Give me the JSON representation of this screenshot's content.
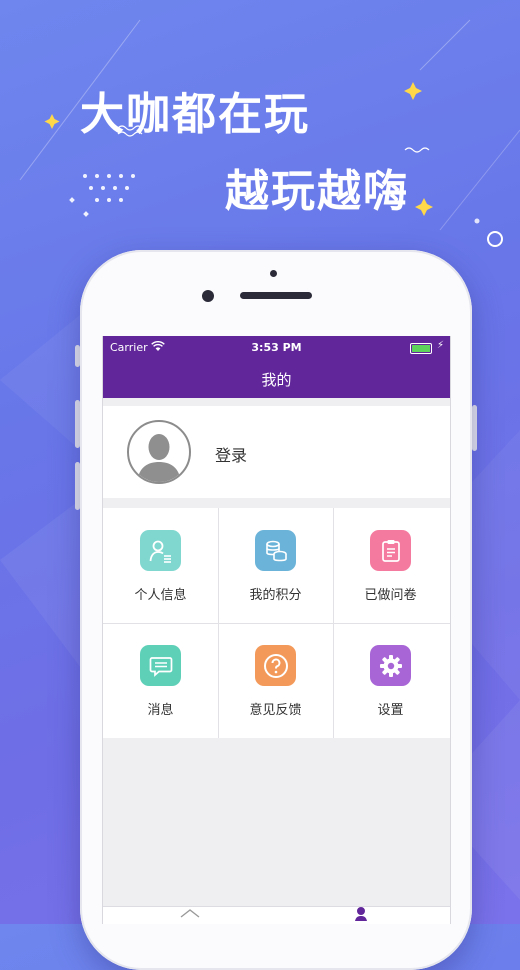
{
  "promo": {
    "headline1": "大咖都在玩",
    "headline2": "越玩越嗨"
  },
  "status_bar": {
    "carrier": "Carrier",
    "time": "3:53 PM"
  },
  "nav": {
    "title": "我的"
  },
  "profile": {
    "login_label": "登录"
  },
  "menu": [
    {
      "label": "个人信息",
      "icon": "person-card-icon",
      "color": "#7fd7cf"
    },
    {
      "label": "我的积分",
      "icon": "coins-icon",
      "color": "#6bb3d8"
    },
    {
      "label": "已做问卷",
      "icon": "clipboard-icon",
      "color": "#f57aa0"
    },
    {
      "label": "消息",
      "icon": "message-icon",
      "color": "#5fd0b8"
    },
    {
      "label": "意见反馈",
      "icon": "question-icon",
      "color": "#f39a5a"
    },
    {
      "label": "设置",
      "icon": "gear-icon",
      "color": "#a765d6"
    }
  ],
  "colors": {
    "navbar": "#61269a",
    "background_gradient_start": "#6f86ee",
    "background_gradient_end": "#7a72ea"
  }
}
